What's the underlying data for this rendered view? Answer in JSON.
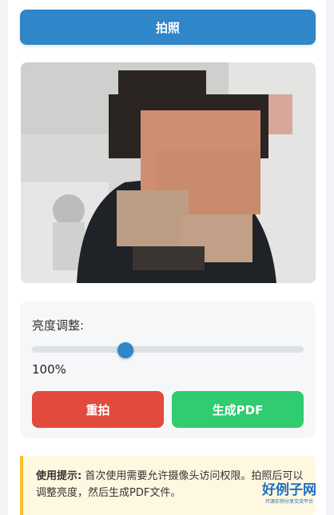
{
  "capture_button": {
    "label": "拍照"
  },
  "preview": {},
  "controls": {
    "brightness_label": "亮度调整:",
    "brightness_value": "100%",
    "brightness_level": 0.343,
    "retake_label": "重拍",
    "pdf_label": "生成PDF"
  },
  "tip": {
    "title": "使用提示:",
    "text": "首次使用需要允许摄像头访问权限。拍照后可以调整亮度，然后生成PDF文件。"
  },
  "logo": {
    "main": "好例子网",
    "sub": "开源实例分享交流平台"
  },
  "colors": {
    "primary": "#2f86c8",
    "danger": "#e24a3d",
    "success": "#2fcc70",
    "tip_border": "#f5c02a"
  }
}
